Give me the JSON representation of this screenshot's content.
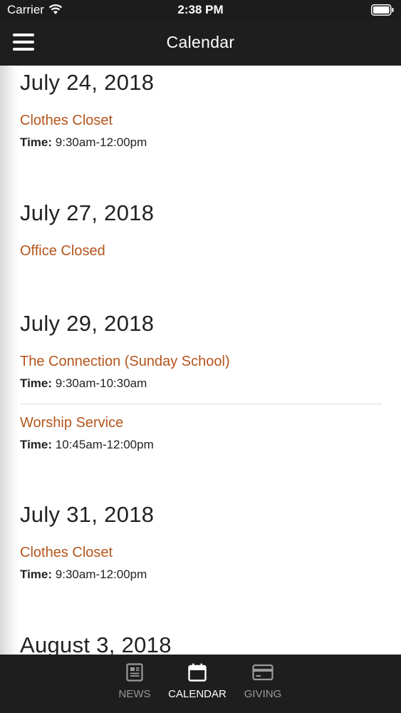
{
  "status_bar": {
    "carrier": "Carrier",
    "time": "2:38 PM"
  },
  "nav": {
    "title": "Calendar"
  },
  "days": [
    {
      "date": "July 24, 2018",
      "events": [
        {
          "title": "Clothes Closet",
          "time_label": "Time:",
          "time": "9:30am-12:00pm"
        }
      ]
    },
    {
      "date": "July 27, 2018",
      "events": [
        {
          "title": "Office Closed"
        }
      ]
    },
    {
      "date": "July 29, 2018",
      "events": [
        {
          "title": "The Connection (Sunday School)",
          "time_label": "Time:",
          "time": "9:30am-10:30am"
        },
        {
          "title": "Worship Service",
          "time_label": "Time:",
          "time": "10:45am-12:00pm"
        }
      ]
    },
    {
      "date": "July 31, 2018",
      "events": [
        {
          "title": "Clothes Closet",
          "time_label": "Time:",
          "time": "9:30am-12:00pm"
        }
      ]
    },
    {
      "date": "August 3, 2018",
      "events": []
    }
  ],
  "tabs": [
    {
      "label": "NEWS",
      "icon": "newspaper-icon",
      "active": false
    },
    {
      "label": "CALENDAR",
      "icon": "calendar-icon",
      "active": true
    },
    {
      "label": "GIVING",
      "icon": "credit-card-icon",
      "active": false
    }
  ],
  "colors": {
    "accent": "#b5551c",
    "bar": "#1e1e1e",
    "inactive_tab": "#9a9a9a"
  }
}
